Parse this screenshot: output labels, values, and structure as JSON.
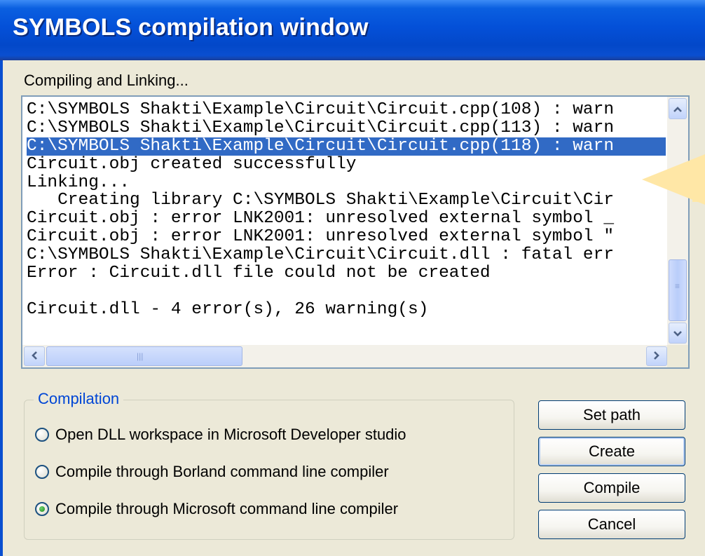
{
  "window": {
    "title": "SYMBOLS compilation window"
  },
  "status_label": "Compiling and Linking...",
  "log": {
    "lines": [
      "C:\\SYMBOLS Shakti\\Example\\Circuit\\Circuit.cpp(108) : warn",
      "C:\\SYMBOLS Shakti\\Example\\Circuit\\Circuit.cpp(113) : warn",
      "C:\\SYMBOLS Shakti\\Example\\Circuit\\Circuit.cpp(118) : warn",
      "Circuit.obj created successfully",
      "Linking...",
      "   Creating library C:\\SYMBOLS Shakti\\Example\\Circuit\\Cir",
      "Circuit.obj : error LNK2001: unresolved external symbol _",
      "Circuit.obj : error LNK2001: unresolved external symbol \"",
      "C:\\SYMBOLS Shakti\\Example\\Circuit\\Circuit.dll : fatal err",
      "Error : Circuit.dll file could not be created",
      "",
      "Circuit.dll - 4 error(s), 26 warning(s)"
    ],
    "selected_index": 2
  },
  "compilation": {
    "legend": "Compilation",
    "options": [
      {
        "label": "Open DLL workspace in Microsoft Developer studio",
        "checked": false
      },
      {
        "label": "Compile through Borland command line compiler",
        "checked": false
      },
      {
        "label": "Compile through Microsoft command line compiler",
        "checked": true
      }
    ]
  },
  "buttons": {
    "set_path": "Set path",
    "create": "Create",
    "compile": "Compile",
    "cancel": "Cancel"
  },
  "icons": {
    "scroll_up": "chevron-up-icon",
    "scroll_down": "chevron-down-icon",
    "scroll_left": "chevron-left-icon",
    "scroll_right": "chevron-right-icon"
  },
  "colors": {
    "title_bar": "#0450d8",
    "selection": "#316ac5",
    "group_legend": "#0046d5",
    "radio_dot": "#1f8a1f"
  }
}
